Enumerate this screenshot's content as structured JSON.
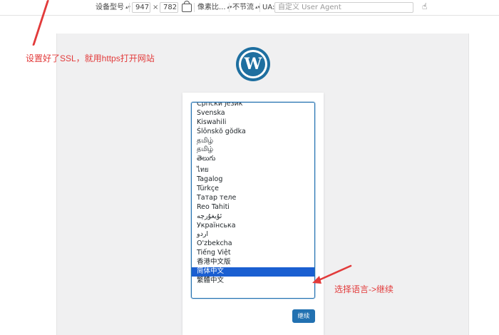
{
  "toolbar": {
    "device_type": "设备型号",
    "width": "947",
    "times": "×",
    "height": "782",
    "pixel_ratio": "像素比...",
    "throttle": "不节流",
    "ua_label": "UA:",
    "ua_placeholder": "自定义 User Agent"
  },
  "annotations": {
    "ssl_note": "设置好了SSL，就用https打开网站",
    "language_note": "选择语言->继续"
  },
  "language_list": {
    "items": [
      "Српски језик",
      "Svenska",
      "Kiswahili",
      "Ślōnskŏ gŏdka",
      "தமிழ்",
      "தமிழ்",
      "తెలుగు",
      "ไทย",
      "Tagalog",
      "Türkçe",
      "Татар теле",
      "Reo Tahiti",
      "ئۇيغۇرچە",
      "Українська",
      "اردو",
      "O'zbekcha",
      "Tiếng Việt",
      "香港中文版",
      "简体中文",
      "繁體中文"
    ],
    "selected_index": 18
  },
  "continue_button": "继续",
  "colors": {
    "wp_blue": "#2271b1",
    "selection": "#1b5fd1",
    "annotation_red": "#e23b3b"
  }
}
